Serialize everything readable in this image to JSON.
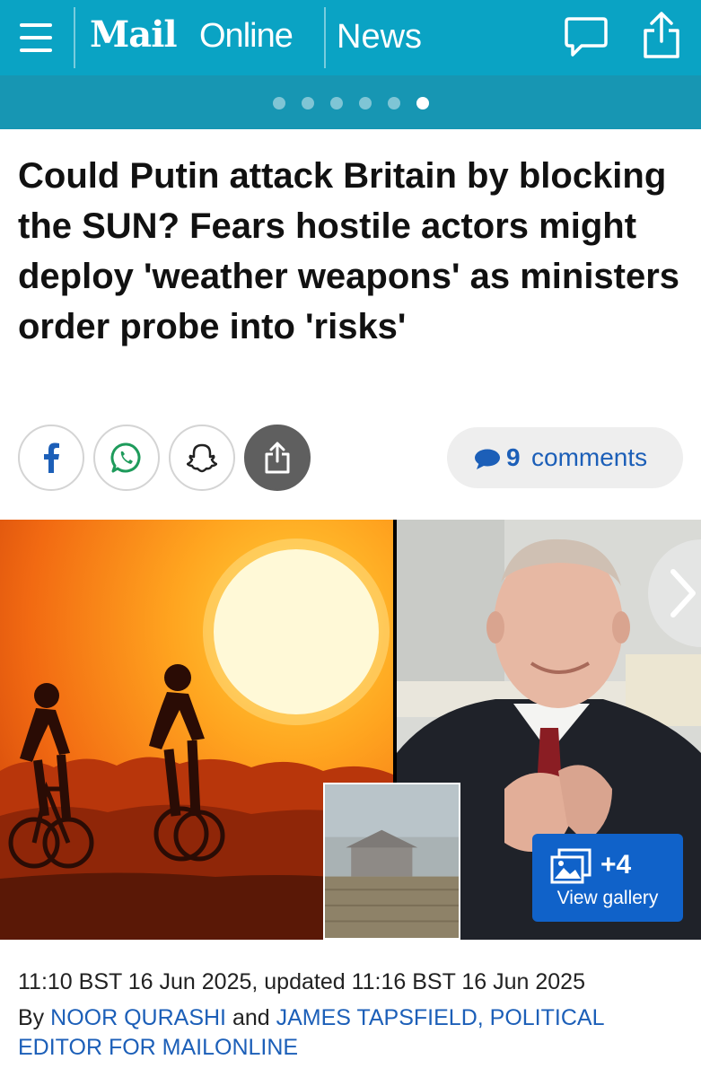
{
  "header": {
    "logo_mail": "Mail",
    "logo_online": "Online",
    "section": "News",
    "icons": [
      "menu-icon",
      "comment-bubble-icon",
      "share-icon"
    ],
    "brand_color": "#0aa3c4"
  },
  "carousel": {
    "dot_count": 6,
    "active_index": 5
  },
  "article": {
    "headline": "Could Putin attack Britain by blocking the SUN? Fears hostile actors might deploy 'weather weapons' as ministers order probe into 'risks'",
    "share_buttons": [
      "facebook-icon",
      "whatsapp-icon",
      "snapchat-icon",
      "share-icon"
    ],
    "comments_count": "9",
    "comments_label": "comments",
    "gallery": {
      "extra_count": "+4",
      "label": "View gallery"
    },
    "timestamp": "11:10 BST 16 Jun 2025, updated 11:16 BST 16 Jun 2025",
    "byline": {
      "prefix": "By",
      "author1": "NOOR QURASHI",
      "conjunction": "and",
      "author2": "JAMES TAPSFIELD, POLITICAL EDITOR FOR MAILONLINE"
    }
  }
}
